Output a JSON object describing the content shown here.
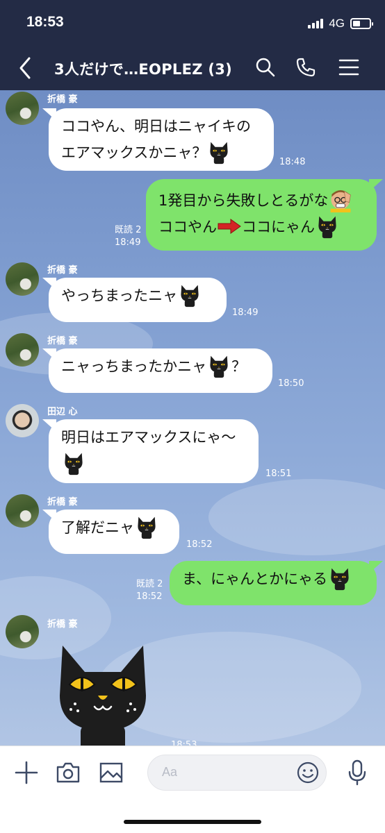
{
  "status_bar": {
    "time": "18:53",
    "network": "4G",
    "battery_level": 0.45
  },
  "header": {
    "title": "3人だけで…EOPLEZ (3)",
    "icons": [
      "back-icon",
      "search-icon",
      "call-icon",
      "menu-icon"
    ]
  },
  "messages": [
    {
      "sender": "折橋 豪",
      "text_line1": "ココやん、明日はニャイキの",
      "text_line2": "エアマックスかニャ？",
      "time": "18:48"
    },
    {
      "line1": "1発目から失敗しとるがな",
      "line2_a": "ココやん",
      "line2_b": "ココにゃん",
      "read": "既読 2",
      "time": "18:49"
    },
    {
      "sender": "折橋 豪",
      "text": "やっちまったニャ",
      "time": "18:49"
    },
    {
      "sender": "折橋 豪",
      "text_a": "ニャっちまったかニャ",
      "text_b": "？",
      "time": "18:50"
    },
    {
      "sender": "田辺 心",
      "text": "明日はエアマックスにゃ〜",
      "time": "18:51"
    },
    {
      "sender": "折橋 豪",
      "text": "了解だニャ",
      "time": "18:52"
    },
    {
      "text": "ま、にゃんとかにゃる",
      "read": "既読 2",
      "time": "18:52"
    },
    {
      "sender": "折橋 豪",
      "sticker": "black-cat-sticker",
      "time": "18:53"
    }
  ],
  "composer": {
    "placeholder": "Aa",
    "icons": [
      "plus-icon",
      "camera-icon",
      "image-icon",
      "emoji-icon",
      "mic-icon"
    ]
  },
  "colors": {
    "header_bg": "#232b45",
    "outgoing_bubble": "#7fe36b",
    "incoming_bubble": "#ffffff"
  }
}
